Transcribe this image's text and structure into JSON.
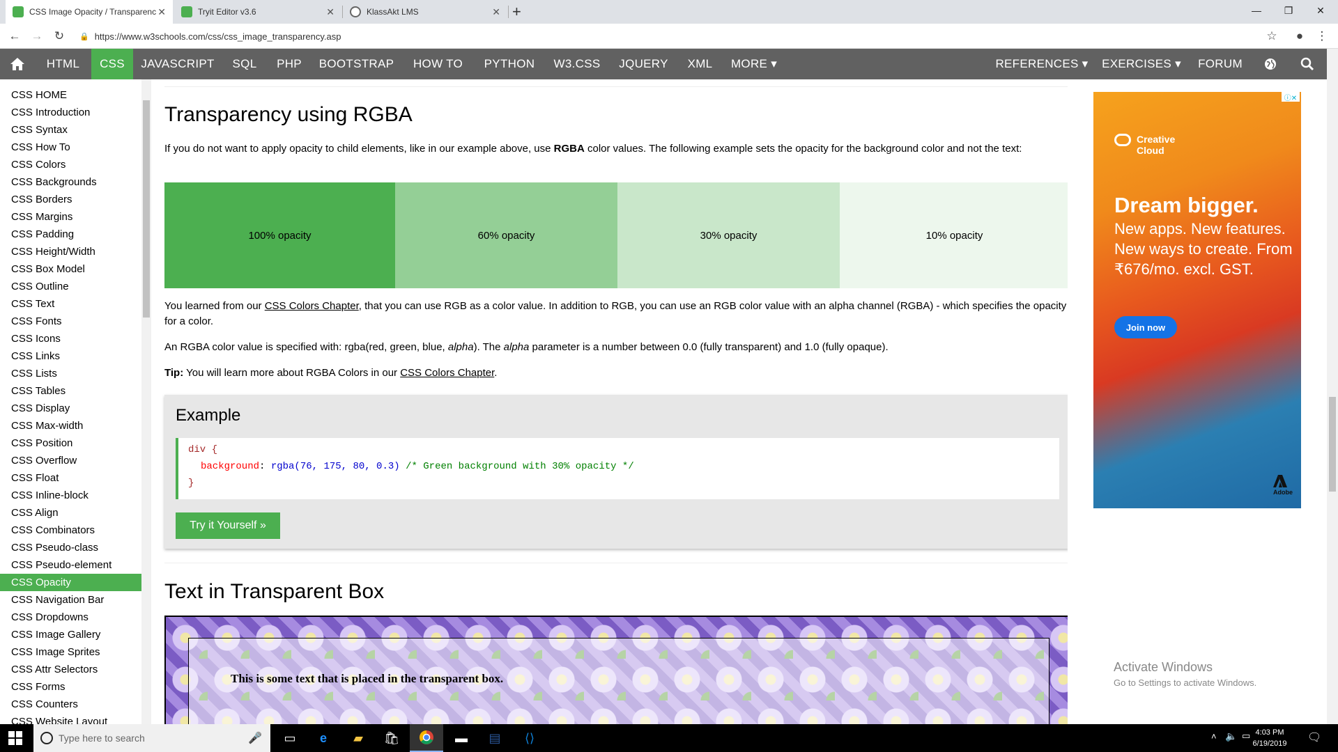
{
  "browser": {
    "tabs": [
      {
        "title": "CSS Image Opacity / Transparenc"
      },
      {
        "title": "Tryit Editor v3.6"
      },
      {
        "title": "KlassAkt LMS"
      }
    ],
    "url": "https://www.w3schools.com/css/css_image_transparency.asp"
  },
  "topnav": {
    "items": [
      "HTML",
      "CSS",
      "JAVASCRIPT",
      "SQL",
      "PHP",
      "BOOTSTRAP",
      "HOW TO",
      "PYTHON",
      "W3.CSS",
      "JQUERY",
      "XML",
      "MORE ▾",
      "REFERENCES ▾",
      "EXERCISES ▾",
      "FORUM"
    ],
    "active": "CSS"
  },
  "sidebar": {
    "links": [
      "CSS HOME",
      "CSS Introduction",
      "CSS Syntax",
      "CSS How To",
      "CSS Colors",
      "CSS Backgrounds",
      "CSS Borders",
      "CSS Margins",
      "CSS Padding",
      "CSS Height/Width",
      "CSS Box Model",
      "CSS Outline",
      "CSS Text",
      "CSS Fonts",
      "CSS Icons",
      "CSS Links",
      "CSS Lists",
      "CSS Tables",
      "CSS Display",
      "CSS Max-width",
      "CSS Position",
      "CSS Overflow",
      "CSS Float",
      "CSS Inline-block",
      "CSS Align",
      "CSS Combinators",
      "CSS Pseudo-class",
      "CSS Pseudo-element",
      "CSS Opacity",
      "CSS Navigation Bar",
      "CSS Dropdowns",
      "CSS Image Gallery",
      "CSS Image Sprites",
      "CSS Attr Selectors",
      "CSS Forms",
      "CSS Counters",
      "CSS Website Layout"
    ],
    "active": "CSS Opacity"
  },
  "content": {
    "heading1": "Transparency using RGBA",
    "intro": {
      "part1": "If you do not want to apply opacity to child elements, like in our example above, use ",
      "bold": "RGBA",
      "part2": " color values. The following example sets the opacity for the background color and not the text:"
    },
    "opacity_demo": [
      {
        "label": "100% opacity",
        "color": "#4CAF50",
        "opacity": 1.0
      },
      {
        "label": "60% opacity",
        "color": "#4CAF50",
        "opacity": 0.6
      },
      {
        "label": "30% opacity",
        "color": "#4CAF50",
        "opacity": 0.3
      },
      {
        "label": "10% opacity",
        "color": "#4CAF50",
        "opacity": 0.1
      }
    ],
    "para1": {
      "part1": "You learned from our ",
      "link": "CSS Colors Chapter",
      "part2": ", that you can use RGB as a color value. In addition to RGB, you can use an RGB color value with an alpha channel (RGBA) - which specifies the opacity for a color."
    },
    "para2": {
      "part1": "An RGBA color value is specified with: rgba(red, green, blue, ",
      "alpha1": "alpha",
      "part2": "). The ",
      "alpha2": "alpha",
      "part3": " parameter is a number between 0.0 (fully transparent) and 1.0 (fully opaque)."
    },
    "tip": {
      "label": "Tip:",
      "text": " You will learn more about RGBA Colors in our ",
      "link": "CSS Colors Chapter",
      "end": "."
    },
    "example": {
      "title": "Example",
      "code_selector": "div {",
      "code_property": "background",
      "code_colon": ": ",
      "code_value": "rgba(76, 175, 80, 0.3)",
      "code_comment": " /* Green background with 30% opacity */",
      "code_close": "}",
      "button": "Try it Yourself »"
    },
    "heading2": "Text in Transparent Box",
    "transparent_box_text": "This is some text that is placed in the transparent box."
  },
  "ad": {
    "brand": "Creative Cloud",
    "headline": "Dream bigger.",
    "subline": "New apps. New features. New ways to create. From ₹676/mo. excl. GST.",
    "button": "Join now",
    "logo": "Adobe"
  },
  "watermark": {
    "line1": "Activate Windows",
    "line2": "Go to Settings to activate Windows."
  },
  "taskbar": {
    "search_placeholder": "Type here to search",
    "time": "4:03 PM",
    "date": "6/19/2019"
  }
}
